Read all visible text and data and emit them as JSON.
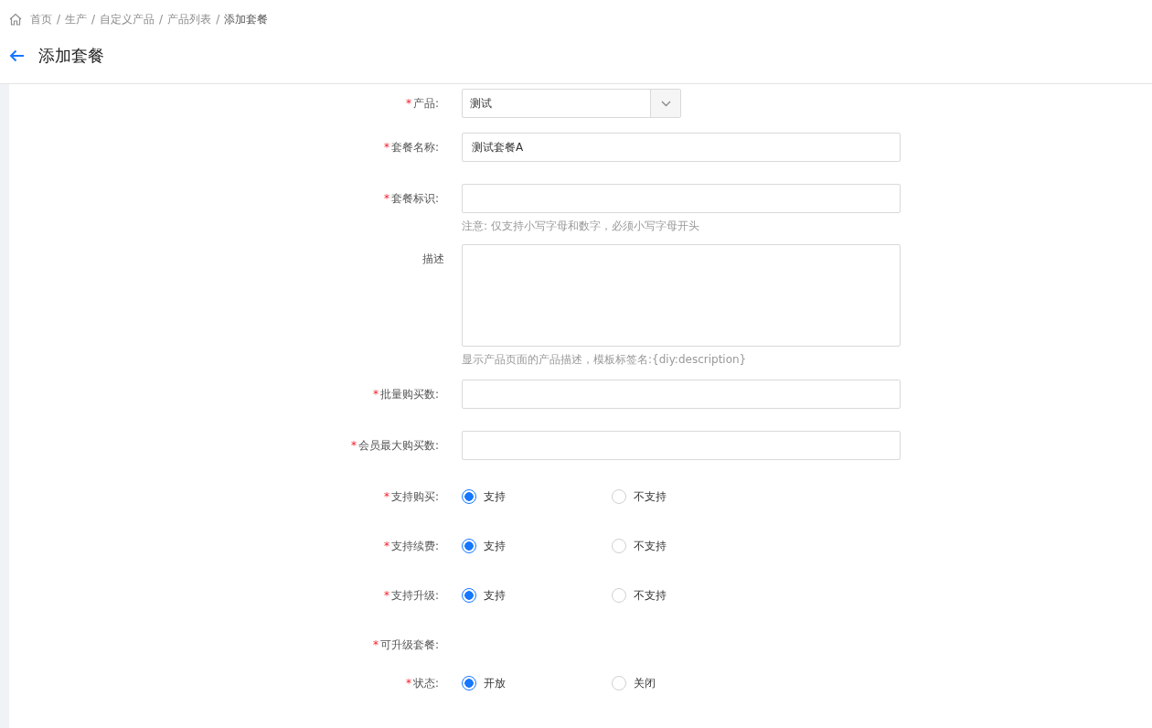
{
  "breadcrumb": [
    {
      "label": "首页",
      "current": false
    },
    {
      "label": "生产",
      "current": false
    },
    {
      "label": "自定义产品",
      "current": false
    },
    {
      "label": "产品列表",
      "current": false
    },
    {
      "label": "添加套餐",
      "current": true
    }
  ],
  "breadcrumb_separator": "/",
  "page_title": "添加套餐",
  "fields": [
    {
      "kind": "select",
      "mark": "*",
      "label": "产品:",
      "value": "测试"
    },
    {
      "kind": "input",
      "mark": "*",
      "label": "套餐名称:",
      "value": "测试套餐A"
    },
    {
      "kind": "input",
      "mark": "*",
      "label": "套餐标识:",
      "hint": "注意: 仅支持小写字母和数字，必须小写字母开头"
    },
    {
      "kind": "textarea",
      "label": "描述",
      "hint": "显示产品页面的产品描述，模板标签名:{diy:description}"
    },
    {
      "kind": "input",
      "mark": "*",
      "label": "批量购买数:"
    },
    {
      "kind": "input",
      "mark": "*",
      "label": "会员最大购买数:"
    },
    {
      "kind": "radio",
      "mark": "*",
      "label": "支持购买:",
      "options": [
        {
          "label": "支持",
          "selected": true
        },
        {
          "label": "不支持",
          "selected": false
        }
      ]
    },
    {
      "kind": "radio",
      "mark": "*",
      "label": "支持续费:",
      "options": [
        {
          "label": "支持",
          "selected": true
        },
        {
          "label": "不支持",
          "selected": false
        }
      ]
    },
    {
      "kind": "radio",
      "mark": "*",
      "label": "支持升级:",
      "options": [
        {
          "label": "支持",
          "selected": true
        },
        {
          "label": "不支持",
          "selected": false
        }
      ]
    },
    {
      "kind": "empty",
      "mark": "*",
      "label": "可升级套餐:"
    },
    {
      "kind": "radio",
      "mark": "*",
      "label": "状态:",
      "options": [
        {
          "label": "开放",
          "selected": true
        },
        {
          "label": "关闭",
          "selected": false
        }
      ]
    }
  ]
}
